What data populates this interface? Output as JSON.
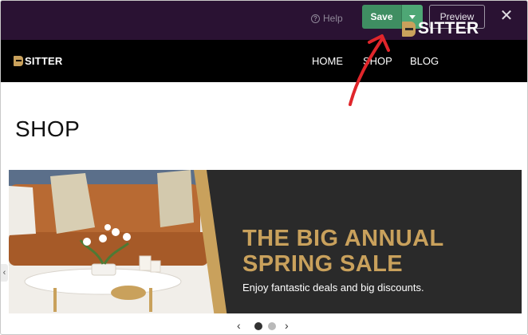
{
  "editor_bar": {
    "help_label": "Help",
    "save_label": "Save",
    "preview_label": "Preview",
    "close_symbol": "✕"
  },
  "site": {
    "logo_text": "SITTER",
    "nav": [
      "HOME",
      "SHOP",
      "BLOG"
    ]
  },
  "page": {
    "title": "SHOP"
  },
  "banner": {
    "logo_text": "SITTER",
    "headline_line1": "THE BIG ANNUAL",
    "headline_line2": "SPRING SALE",
    "subtext": "Enjoy fantastic deals and big discounts."
  },
  "carousel": {
    "prev_symbol": "‹",
    "next_symbol": "›",
    "total_slides": 2,
    "active_slide": 1
  },
  "colors": {
    "editor_bar_bg": "#2a1233",
    "save_green": "#3f8e62",
    "gold_accent": "#c9a15c",
    "annotation_red": "#e0262b"
  },
  "icons": {
    "help": "question-circle-icon",
    "save_menu": "caret-down-icon",
    "close": "close-icon",
    "logo": "sitter-logo-icon",
    "annotation": "red-arrow-icon"
  }
}
